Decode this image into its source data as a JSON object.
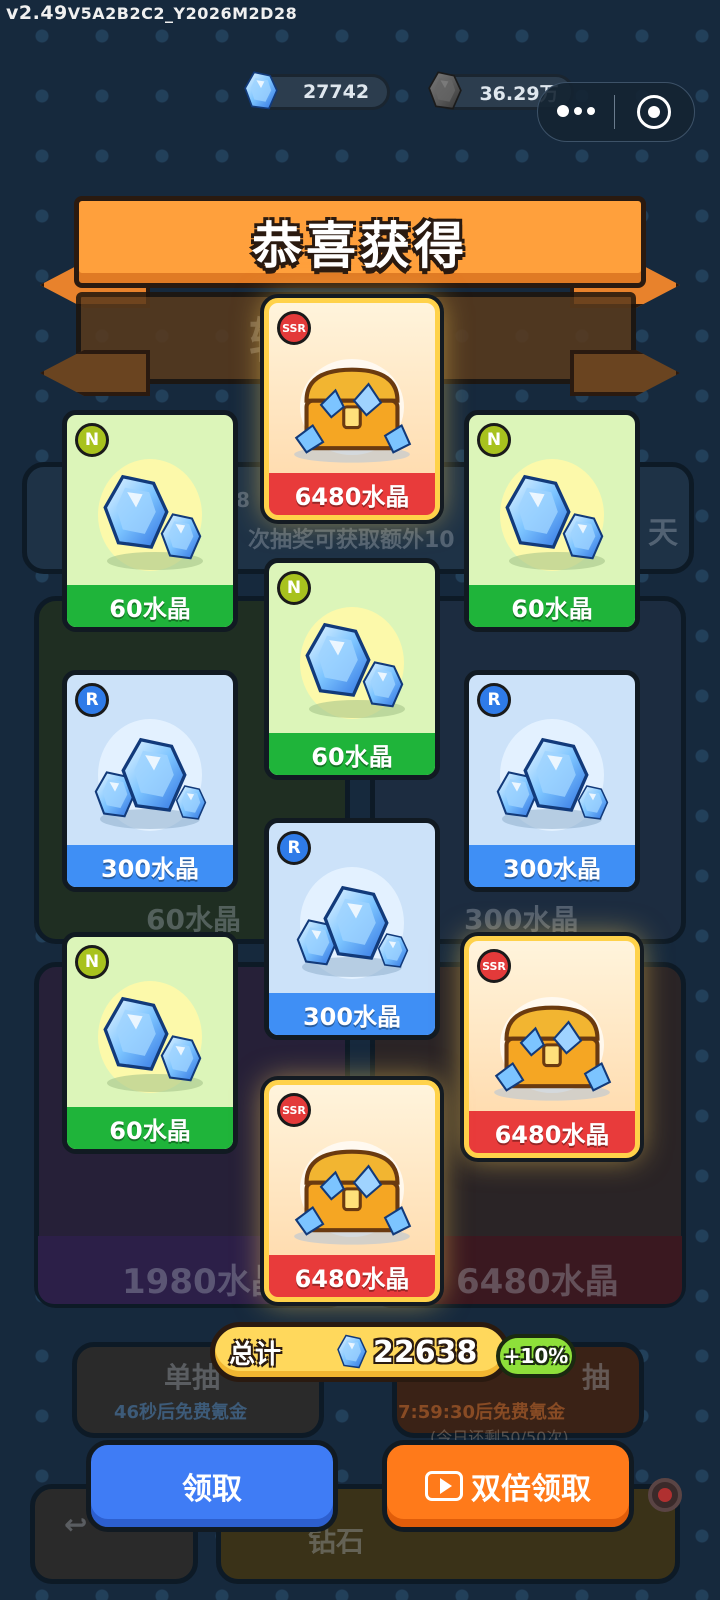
{
  "version": {
    "main": "v2.49",
    "build": "V5A2B2C2_Y2026M2D28"
  },
  "currencies": [
    {
      "icon": "crystal-icon",
      "value": "27742"
    },
    {
      "icon": "dark-crystal-icon",
      "value": "36.29万"
    }
  ],
  "background": {
    "partial_banner": "轮奖",
    "notice_text": "次抽奖可获取额外10",
    "notice_prefix": "8",
    "day_text": "天",
    "left_pack_label": "60水晶",
    "right_pack_label": "300水晶",
    "bottom_left_price": "1980水晶",
    "bottom_right_price": "6480水晶",
    "single_draw_label": "单抽",
    "single_draw_timer": "46秒后免费氪金",
    "multi_draw_label": "抽",
    "multi_draw_timer": "7:59:30后免费氪金",
    "multi_draw_remaining": "(今日还剩50/50次)",
    "back_icon": "back-arrow-icon",
    "diamond_tab": "钻石"
  },
  "banner": {
    "title": "恭喜获得"
  },
  "rewards": [
    {
      "rarity": "SSR",
      "label": "6480水晶",
      "icon": "treasure-chest-icon"
    },
    {
      "rarity": "N",
      "label": "60水晶",
      "icon": "crystal-pair-icon"
    },
    {
      "rarity": "N",
      "label": "60水晶",
      "icon": "crystal-pair-icon"
    },
    {
      "rarity": "N",
      "label": "60水晶",
      "icon": "crystal-pair-icon"
    },
    {
      "rarity": "R",
      "label": "300水晶",
      "icon": "crystal-pile-icon"
    },
    {
      "rarity": "R",
      "label": "300水晶",
      "icon": "crystal-pile-icon"
    },
    {
      "rarity": "R",
      "label": "300水晶",
      "icon": "crystal-pile-icon"
    },
    {
      "rarity": "N",
      "label": "60水晶",
      "icon": "crystal-pair-icon"
    },
    {
      "rarity": "SSR",
      "label": "6480水晶",
      "icon": "treasure-chest-icon"
    },
    {
      "rarity": "SSR",
      "label": "6480水晶",
      "icon": "treasure-chest-icon"
    }
  ],
  "total": {
    "label": "总计",
    "value": "22638",
    "bonus": "+10%"
  },
  "buttons": {
    "claim": "领取",
    "double_claim": "双倍领取"
  },
  "colors": {
    "n_card": "#dcf5b9",
    "r_card": "#cce2f9",
    "ssr_border": "#ffd24a",
    "claim_btn": "#3f7cf5",
    "double_btn": "#ff7a1a"
  }
}
